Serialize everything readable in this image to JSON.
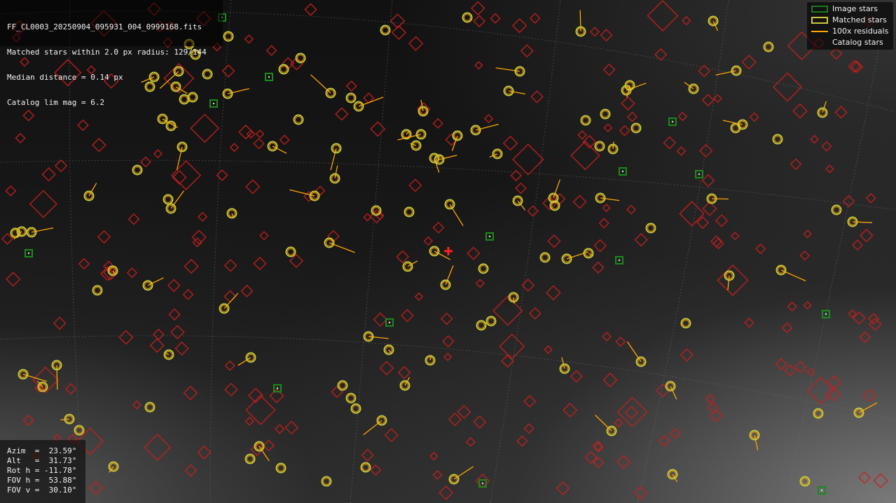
{
  "header": {
    "filename": "FF_CL0003_20250904_095931_004_0999168.fits",
    "match_summary": "Matched stars within 2.0 px radius: 129/144",
    "median_distance": "Median distance = 0.14 px",
    "catalog_limit": "Catalog lim mag = 6.2"
  },
  "legend": {
    "items": [
      {
        "label": "Image stars",
        "icon": "green-square-icon"
      },
      {
        "label": "Matched stars",
        "icon": "yellow-ring-icon"
      },
      {
        "label": "100x residuals",
        "icon": "orange-line-icon"
      },
      {
        "label": "Catalog stars",
        "icon": "red-diamond-icon"
      }
    ]
  },
  "pointing": {
    "azim": "Azim  =  23.59°",
    "alt": "Alt   =  31.73°",
    "rot": "Rot h = -11.78°",
    "fov_h": "FOV h =  53.88°",
    "fov_v": "FOV v =  30.10°"
  },
  "colors": {
    "catalog": "#c81e1e",
    "image": "#1a8a1a",
    "matched": "#c8c83c",
    "residual": "#ffa500",
    "center": "#ff2020",
    "grid": "#777777"
  }
}
